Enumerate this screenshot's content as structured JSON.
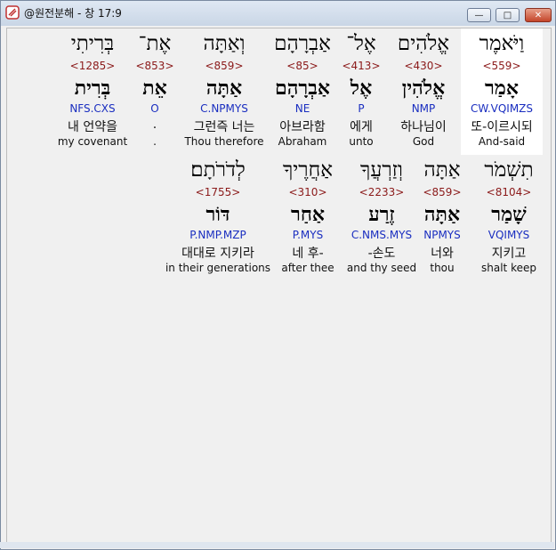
{
  "window": {
    "title": "@원전분해 - 창 17:9",
    "minimize_glyph": "—",
    "maximize_glyph": "□",
    "close_glyph": "✕"
  },
  "rows": [
    [
      {
        "heb1": "וַיֹּאמֶר",
        "num": "<559>",
        "heb2": "אָמַר",
        "code": "CW.VQIMZS",
        "kor": "또-이르시되",
        "eng": "And-said",
        "highlight": true
      },
      {
        "heb1": "אֱלֹהִים",
        "num": "<430>",
        "heb2": "אֱלֹהִין",
        "code": "NMP",
        "kor": "하나님이",
        "eng": "God"
      },
      {
        "heb1": "אֶל־",
        "num": "<413>",
        "heb2": "אֶל",
        "code": "P",
        "kor": "에게",
        "eng": "unto"
      },
      {
        "heb1": "אַבְרָהָם",
        "num": "<85>",
        "heb2": "אַבְרָהָם",
        "code": "NE",
        "kor": "아브라함",
        "eng": "Abraham"
      },
      {
        "heb1": "וְאַתָּה",
        "num": "<859>",
        "heb2": "אַתָּה",
        "code": "C.NPMYS",
        "kor": "그런즉 너는",
        "eng": "Thou therefore"
      },
      {
        "heb1": "אֶת־",
        "num": "<853>",
        "heb2": "אֵת",
        "code": "O",
        "kor": ".",
        "eng": "."
      },
      {
        "heb1": "בְּרִיתִי",
        "num": "<1285>",
        "heb2": "בְּרִית",
        "code": "NFS.CXS",
        "kor": "내 언약을",
        "eng": "my covenant"
      }
    ],
    [
      {
        "heb1": "תִשְׁמֹר",
        "num": "<8104>",
        "heb2": "שָׁמַר",
        "code": "VQIMYS",
        "kor": "지키고",
        "eng": "shalt keep"
      },
      {
        "heb1": "אַתָּה",
        "num": "<859>",
        "heb2": "אַתָּה",
        "code": "NPMYS",
        "kor": "너와",
        "eng": "thou"
      },
      {
        "heb1": "וְזַרְעֲךָ",
        "num": "<2233>",
        "heb2": "זֶרַע",
        "code": "C.NMS.MYS",
        "kor": "-손도",
        "eng": "and thy seed"
      },
      {
        "heb1": "אַחֲרֶיךָ",
        "num": "<310>",
        "heb2": "אַחַר",
        "code": "P.MYS",
        "kor": "네 후-",
        "eng": "after thee"
      },
      {
        "heb1": "לְדֹרֹתָם׃",
        "num": "<1755>",
        "heb2": "דּוֹר",
        "code": "P.NMP.MZP",
        "kor": "대대로 지키라",
        "eng": "in their generations"
      }
    ]
  ]
}
